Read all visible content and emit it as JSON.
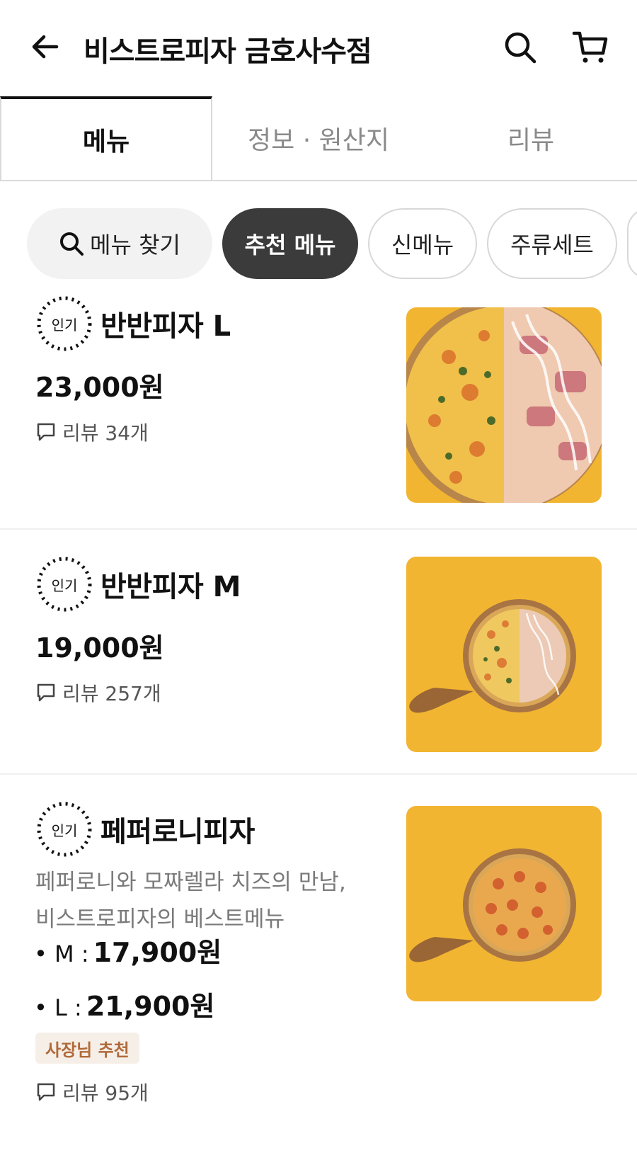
{
  "header": {
    "title": "비스트로피자 금호사수점",
    "icons": [
      "back-arrow-icon",
      "search-icon",
      "cart-icon"
    ]
  },
  "tabs": [
    {
      "label": "메뉴",
      "active": true
    },
    {
      "label": "정보 · 원산지",
      "active": false
    },
    {
      "label": "리뷰",
      "active": false
    }
  ],
  "chips": {
    "search_label": "메뉴 찾기",
    "items": [
      {
        "label": "추천 메뉴",
        "selected": true
      },
      {
        "label": "신메뉴",
        "selected": false
      },
      {
        "label": "주류세트",
        "selected": false
      }
    ]
  },
  "colors": {
    "selected_chip": "#3b3b3b",
    "thumb_background": "#f2b531",
    "owner_badge_text": "#b06a3a",
    "owner_badge_bg": "#f6efe8"
  },
  "menu": [
    {
      "badge": "인기",
      "name": "반반피자 L",
      "price": "23,000원",
      "review": "리뷰 34개"
    },
    {
      "badge": "인기",
      "name": "반반피자 M",
      "price": "19,000원",
      "review": "리뷰 257개"
    },
    {
      "badge": "인기",
      "name": "페퍼로니피자",
      "desc_line1": "페퍼로니와 모짜렐라 치즈의 만남,",
      "desc_line2": "비스트로피자의 베스트메뉴",
      "size_m_label": "• M :",
      "size_m_price": "17,900원",
      "size_l_label": "• L :",
      "size_l_price": "21,900원",
      "owner_badge": "사장님 추천",
      "review": "리뷰 95개"
    }
  ]
}
